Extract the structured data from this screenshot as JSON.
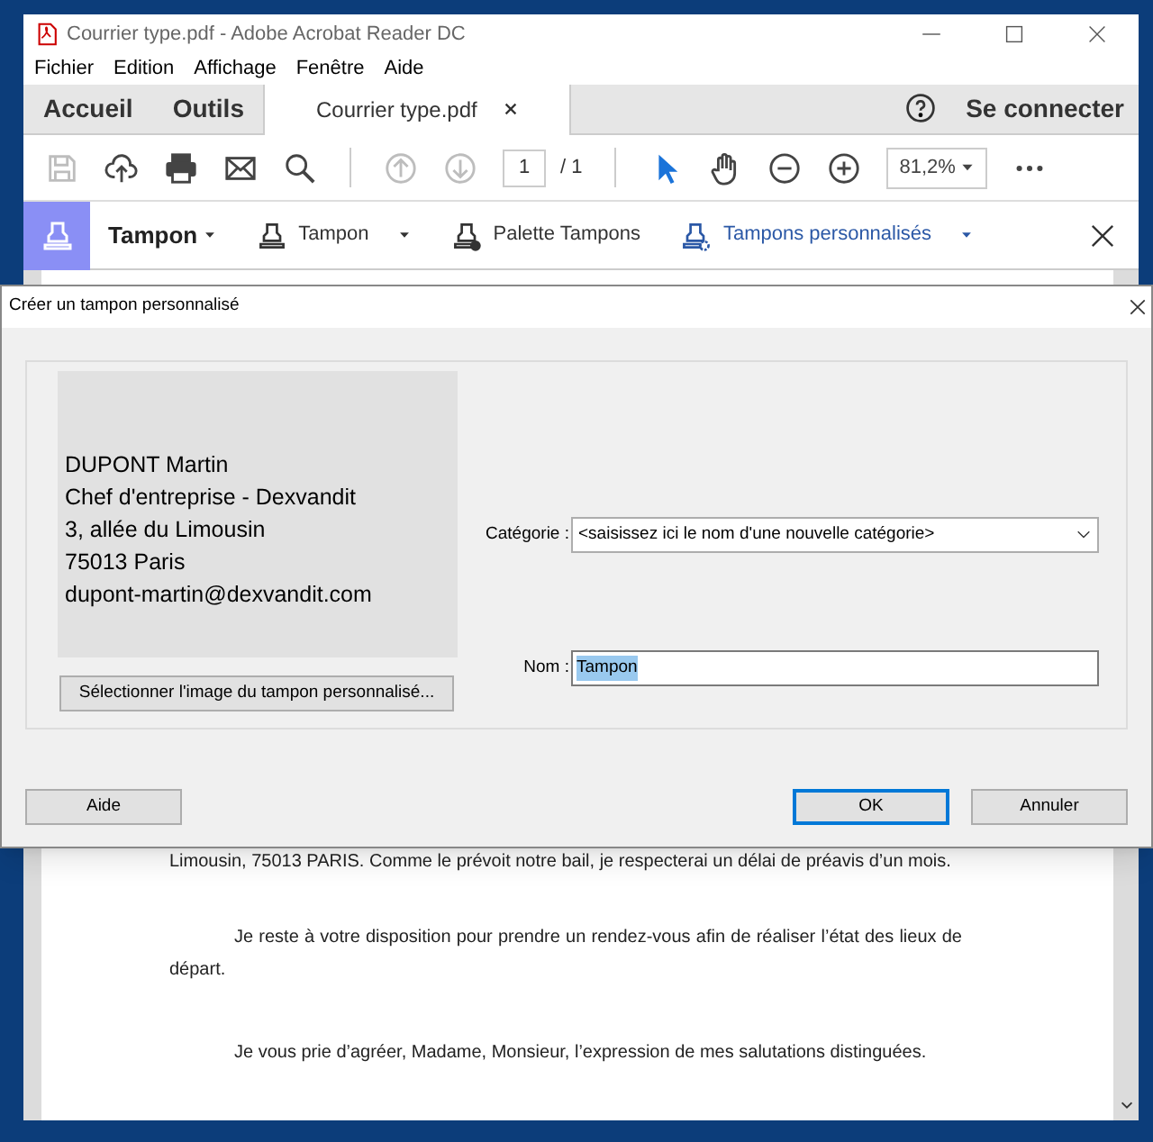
{
  "window": {
    "title": "Courrier type.pdf - Adobe Acrobat Reader DC"
  },
  "menu": [
    "Fichier",
    "Edition",
    "Affichage",
    "Fenêtre",
    "Aide"
  ],
  "tabs": [
    {
      "label": "Accueil",
      "selected": false,
      "kind": "nav"
    },
    {
      "label": "Outils",
      "selected": false,
      "kind": "nav"
    },
    {
      "label": "Courrier type.pdf",
      "selected": true,
      "kind": "document"
    }
  ],
  "sign_in": "Se connecter",
  "toolbar": {
    "buttons": [
      {
        "kind": "save",
        "disabled": true,
        "selected": false
      },
      {
        "kind": "upload",
        "disabled": false,
        "selected": false
      },
      {
        "kind": "print",
        "disabled": false,
        "selected": false
      },
      {
        "kind": "mail",
        "disabled": false,
        "selected": false
      },
      {
        "kind": "search",
        "disabled": false,
        "selected": false
      },
      {
        "kind": "sep"
      },
      {
        "kind": "prev",
        "disabled": true,
        "selected": false
      },
      {
        "kind": "next",
        "disabled": true,
        "selected": false
      },
      {
        "kind": "page"
      },
      {
        "kind": "sep"
      },
      {
        "kind": "pointer",
        "disabled": false,
        "selected": true
      },
      {
        "kind": "hand",
        "disabled": false,
        "selected": false
      },
      {
        "kind": "zoomout",
        "disabled": false,
        "selected": false
      },
      {
        "kind": "zoomin",
        "disabled": false,
        "selected": false
      },
      {
        "kind": "zoom"
      },
      {
        "kind": "more",
        "disabled": false,
        "selected": false
      }
    ],
    "page": "1",
    "page_total": "/ 1",
    "zoom": "81,2%"
  },
  "stamp_bar": {
    "title": "Tampon",
    "items": [
      {
        "label": "Tampon",
        "kind": "stamp",
        "dropdown": true,
        "selected": false
      },
      {
        "label": "Palette Tampons",
        "kind": "palette",
        "dropdown": false,
        "selected": false
      },
      {
        "label": "Tampons personnalisés",
        "kind": "custom",
        "dropdown": true,
        "selected": true
      }
    ]
  },
  "document": {
    "paragraphs": [
      {
        "text": "Limousin, 75013 PARIS. Comme le prévoit notre bail, je respecterai un délai de préavis d’un mois.",
        "indent": false
      },
      {
        "text": "Je reste à votre disposition pour prendre un rendez-vous afin de réaliser l’état des lieux de départ.",
        "indent": true
      },
      {
        "text": "Je vous prie d’agréer, Madame, Monsieur, l’expression de mes salutations distinguées.",
        "indent": true
      }
    ]
  },
  "dialog": {
    "title": "Créer un tampon personnalisé",
    "preview_lines": [
      "DUPONT Martin",
      "Chef d'entreprise - Dexvandit",
      "3, allée du Limousin",
      "75013 Paris",
      "dupont-martin@dexvandit.com"
    ],
    "select_button": "Sélectionner l'image du tampon personnalisé...",
    "category": {
      "label": "Catégorie :",
      "value": "<saisissez ici le nom d'une nouvelle catégorie>"
    },
    "name": {
      "label": "Nom :",
      "value": "Tampon",
      "selected": true
    },
    "buttons": [
      {
        "label": "Aide",
        "default": false
      },
      {
        "label": "OK",
        "default": true
      },
      {
        "label": "Annuler",
        "default": false
      }
    ]
  }
}
